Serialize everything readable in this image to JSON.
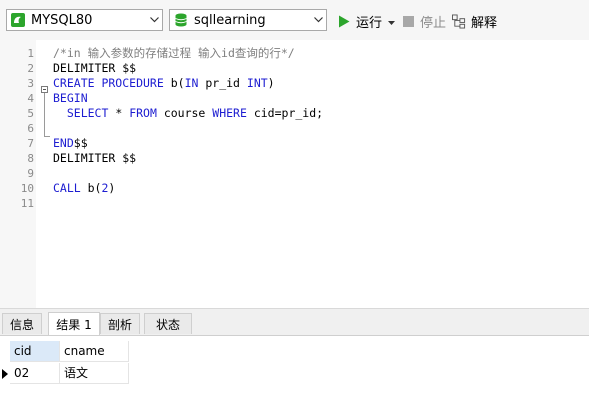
{
  "toolbar": {
    "connection": {
      "value": "MYSQL80",
      "icon": "mysql-connection-icon"
    },
    "database": {
      "value": "sqllearning",
      "icon": "database-icon"
    },
    "run_label": "运行",
    "stop_label": "停止",
    "explain_label": "解释",
    "colors": {
      "run": "#2ca52c",
      "db": "#2ca52c",
      "connection": "#2ca52c"
    }
  },
  "editor": {
    "lines": [
      {
        "num": "1",
        "segments": [
          {
            "t": "/*in 输入参数的存储过程 输入id查询的行*/",
            "c": "cm"
          }
        ]
      },
      {
        "num": "2",
        "segments": [
          {
            "t": "DELIMITER $$",
            "c": ""
          }
        ]
      },
      {
        "num": "3",
        "segments": [
          {
            "t": "CREATE PROCEDURE",
            "c": "kw"
          },
          {
            "t": " b(",
            "c": ""
          },
          {
            "t": "IN",
            "c": "kw"
          },
          {
            "t": " pr_id ",
            "c": ""
          },
          {
            "t": "INT",
            "c": "kw"
          },
          {
            "t": ")",
            "c": ""
          }
        ]
      },
      {
        "num": "4",
        "segments": [
          {
            "t": "BEGIN",
            "c": "kw"
          }
        ]
      },
      {
        "num": "5",
        "segments": [
          {
            "t": "  ",
            "c": ""
          },
          {
            "t": "SELECT",
            "c": "kw"
          },
          {
            "t": " * ",
            "c": ""
          },
          {
            "t": "FROM",
            "c": "kw"
          },
          {
            "t": " course ",
            "c": ""
          },
          {
            "t": "WHERE",
            "c": "kw"
          },
          {
            "t": " cid=pr_id;",
            "c": ""
          }
        ]
      },
      {
        "num": "6",
        "segments": []
      },
      {
        "num": "7",
        "segments": [
          {
            "t": "END",
            "c": "kw"
          },
          {
            "t": "$$",
            "c": ""
          }
        ]
      },
      {
        "num": "8",
        "segments": [
          {
            "t": "DELIMITER $$",
            "c": ""
          }
        ]
      },
      {
        "num": "9",
        "segments": []
      },
      {
        "num": "10",
        "segments": [
          {
            "t": "CALL",
            "c": "kw"
          },
          {
            "t": " b(",
            "c": ""
          },
          {
            "t": "2",
            "c": "kw"
          },
          {
            "t": ")",
            "c": ""
          }
        ]
      },
      {
        "num": "11",
        "segments": []
      }
    ],
    "colors": {
      "keyword": "#1d1dd1",
      "comment": "#7f7f7f"
    }
  },
  "results": {
    "tabs": [
      {
        "label": "信息",
        "active": false
      },
      {
        "label": "结果 1",
        "active": true
      },
      {
        "label": "剖析",
        "active": false
      },
      {
        "label": "状态",
        "active": false
      }
    ],
    "columns": [
      "cid",
      "cname"
    ],
    "rows": [
      [
        "02",
        "语文"
      ]
    ]
  }
}
